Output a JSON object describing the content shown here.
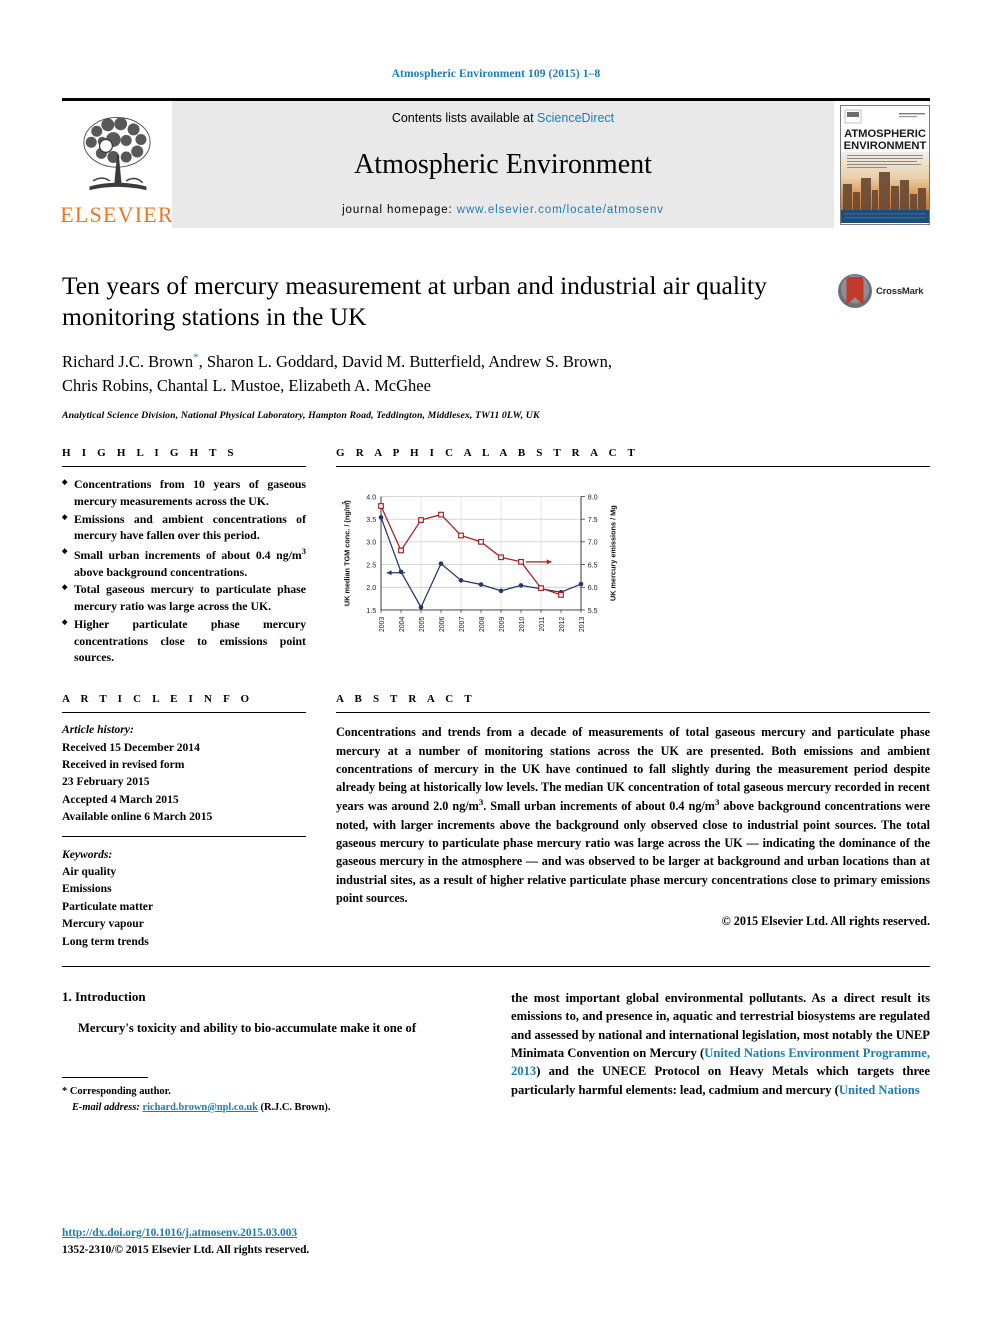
{
  "running_head": "Atmospheric Environment 109 (2015) 1–8",
  "masthead": {
    "publisher_name": "ELSEVIER",
    "contents_prefix": "Contents lists available at ",
    "contents_link": "ScienceDirect",
    "journal_title": "Atmospheric Environment",
    "homepage_prefix": "journal homepage: ",
    "homepage_url": "www.elsevier.com/locate/atmosenv",
    "cover_line1": "ATMOSPHERIC",
    "cover_line2": "ENVIRONMENT"
  },
  "article": {
    "title": "Ten years of mercury measurement at urban and industrial air quality monitoring stations in the UK",
    "crossmark_label": "CrossMark",
    "authors_line1": "Richard J.C. Brown",
    "authors_star": "*",
    "authors_line1_rest": ", Sharon L. Goddard, David M. Butterfield, Andrew S. Brown,",
    "authors_line2": "Chris Robins, Chantal L. Mustoe, Elizabeth A. McGhee",
    "affiliation": "Analytical Science Division, National Physical Laboratory, Hampton Road, Teddington, Middlesex, TW11 0LW, UK"
  },
  "sections": {
    "highlights_heading": "H I G H L I G H T S",
    "graphical_abstract_heading": "G R A P H I C A L  A B S T R A C T",
    "article_info_heading": "A R T I C L E  I N F O",
    "abstract_heading": "A B S T R A C T"
  },
  "highlights": [
    "Concentrations from 10 years of gaseous mercury measurements across the UK.",
    "Emissions and ambient concentrations of mercury have fallen over this period.",
    "Small urban increments of about 0.4 ng/m3 above background concentrations.",
    "Total gaseous mercury to particulate phase mercury ratio was large across the UK.",
    "Higher particulate phase mercury concentrations close to emissions point sources."
  ],
  "article_info": {
    "history_label": "Article history:",
    "history": [
      "Received 15 December 2014",
      "Received in revised form",
      "23 February 2015",
      "Accepted 4 March 2015",
      "Available online 6 March 2015"
    ],
    "keywords_label": "Keywords:",
    "keywords": [
      "Air quality",
      "Emissions",
      "Particulate matter",
      "Mercury vapour",
      "Long term trends"
    ]
  },
  "abstract": {
    "text": "Concentrations and trends from a decade of measurements of total gaseous mercury and particulate phase mercury at a number of monitoring stations across the UK are presented. Both emissions and ambient concentrations of mercury in the UK have continued to fall slightly during the measurement period despite already being at historically low levels. The median UK concentration of total gaseous mercury recorded in recent years was around 2.0 ng/m3. Small urban increments of about 0.4 ng/m3 above background concentrations were noted, with larger increments above the background only observed close to industrial point sources. The total gaseous mercury to particulate phase mercury ratio was large across the UK — indicating the dominance of the gaseous mercury in the atmosphere — and was observed to be larger at background and urban locations than at industrial sites, as a result of higher relative particulate phase mercury concentrations close to primary emissions point sources.",
    "copyright": "© 2015 Elsevier Ltd. All rights reserved."
  },
  "body": {
    "section_number_title": "1. Introduction",
    "left_paragraph": "Mercury's toxicity and ability to bio-accumulate make it one of",
    "right_paragraph_a": "the most important global environmental pollutants. As a direct result its emissions to, and presence in, aquatic and terrestrial biosystems are regulated and assessed by national and international legislation, most notably the UNEP Minimata Convention on Mercury (",
    "right_cite_1": "United Nations Environment Programme, 2013",
    "right_paragraph_b": ") and the UNECE Protocol on Heavy Metals which targets three particularly harmful elements: lead, cadmium and mercury (",
    "right_cite_2": "United Nations"
  },
  "footnotes": {
    "corresponding_marker": "*",
    "corresponding_text": "Corresponding author.",
    "email_label": "E-mail address:",
    "email": "richard.brown@npl.co.uk",
    "email_owner": "(R.J.C. Brown).",
    "doi": "http://dx.doi.org/10.1016/j.atmosenv.2015.03.003",
    "issn_line": "1352-2310/© 2015 Elsevier Ltd. All rights reserved."
  },
  "colors": {
    "link": "#1a7db5",
    "elsevier_orange": "#e87722",
    "series_tgm": "#23376b",
    "series_emissions": "#a61c20",
    "grid": "#bfbfbf"
  },
  "chart_data": {
    "type": "line",
    "title": "",
    "xlabel": "",
    "categories": [
      "2003",
      "2004",
      "2005",
      "2006",
      "2007",
      "2008",
      "2009",
      "2010",
      "2011",
      "2012",
      "2013"
    ],
    "y_left_label": "UK median TGM conc. / (ng/m3)",
    "y_right_label": "UK mercury emissions / Mg",
    "ylim_left": [
      1.5,
      4.0
    ],
    "ylim_right": [
      5.5,
      8.0
    ],
    "y_left_ticks": [
      "1.5",
      "2.0",
      "2.5",
      "3.0",
      "3.5",
      "4.0"
    ],
    "y_right_ticks": [
      "5.5",
      "6.0",
      "6.5",
      "7.0",
      "7.5",
      "8.0"
    ],
    "grid": true,
    "legend": "arrow-annotations",
    "annotations": [
      {
        "name": "left-arrow",
        "points_to": "left-axis"
      },
      {
        "name": "right-arrow",
        "points_to": "right-axis"
      }
    ],
    "series": [
      {
        "name": "UK median TGM conc.",
        "axis": "left",
        "marker": "filled-circle",
        "color": "#23376b",
        "values": [
          3.54,
          2.34,
          1.56,
          2.52,
          2.15,
          2.06,
          1.92,
          2.04,
          null,
          1.89,
          2.07
        ]
      },
      {
        "name": "UK mercury emissions",
        "axis": "right",
        "marker": "open-square",
        "color": "#a61c20",
        "values": [
          7.79,
          6.81,
          7.48,
          7.6,
          7.14,
          7.0,
          6.66,
          6.56,
          5.98,
          5.83,
          null
        ]
      }
    ]
  }
}
